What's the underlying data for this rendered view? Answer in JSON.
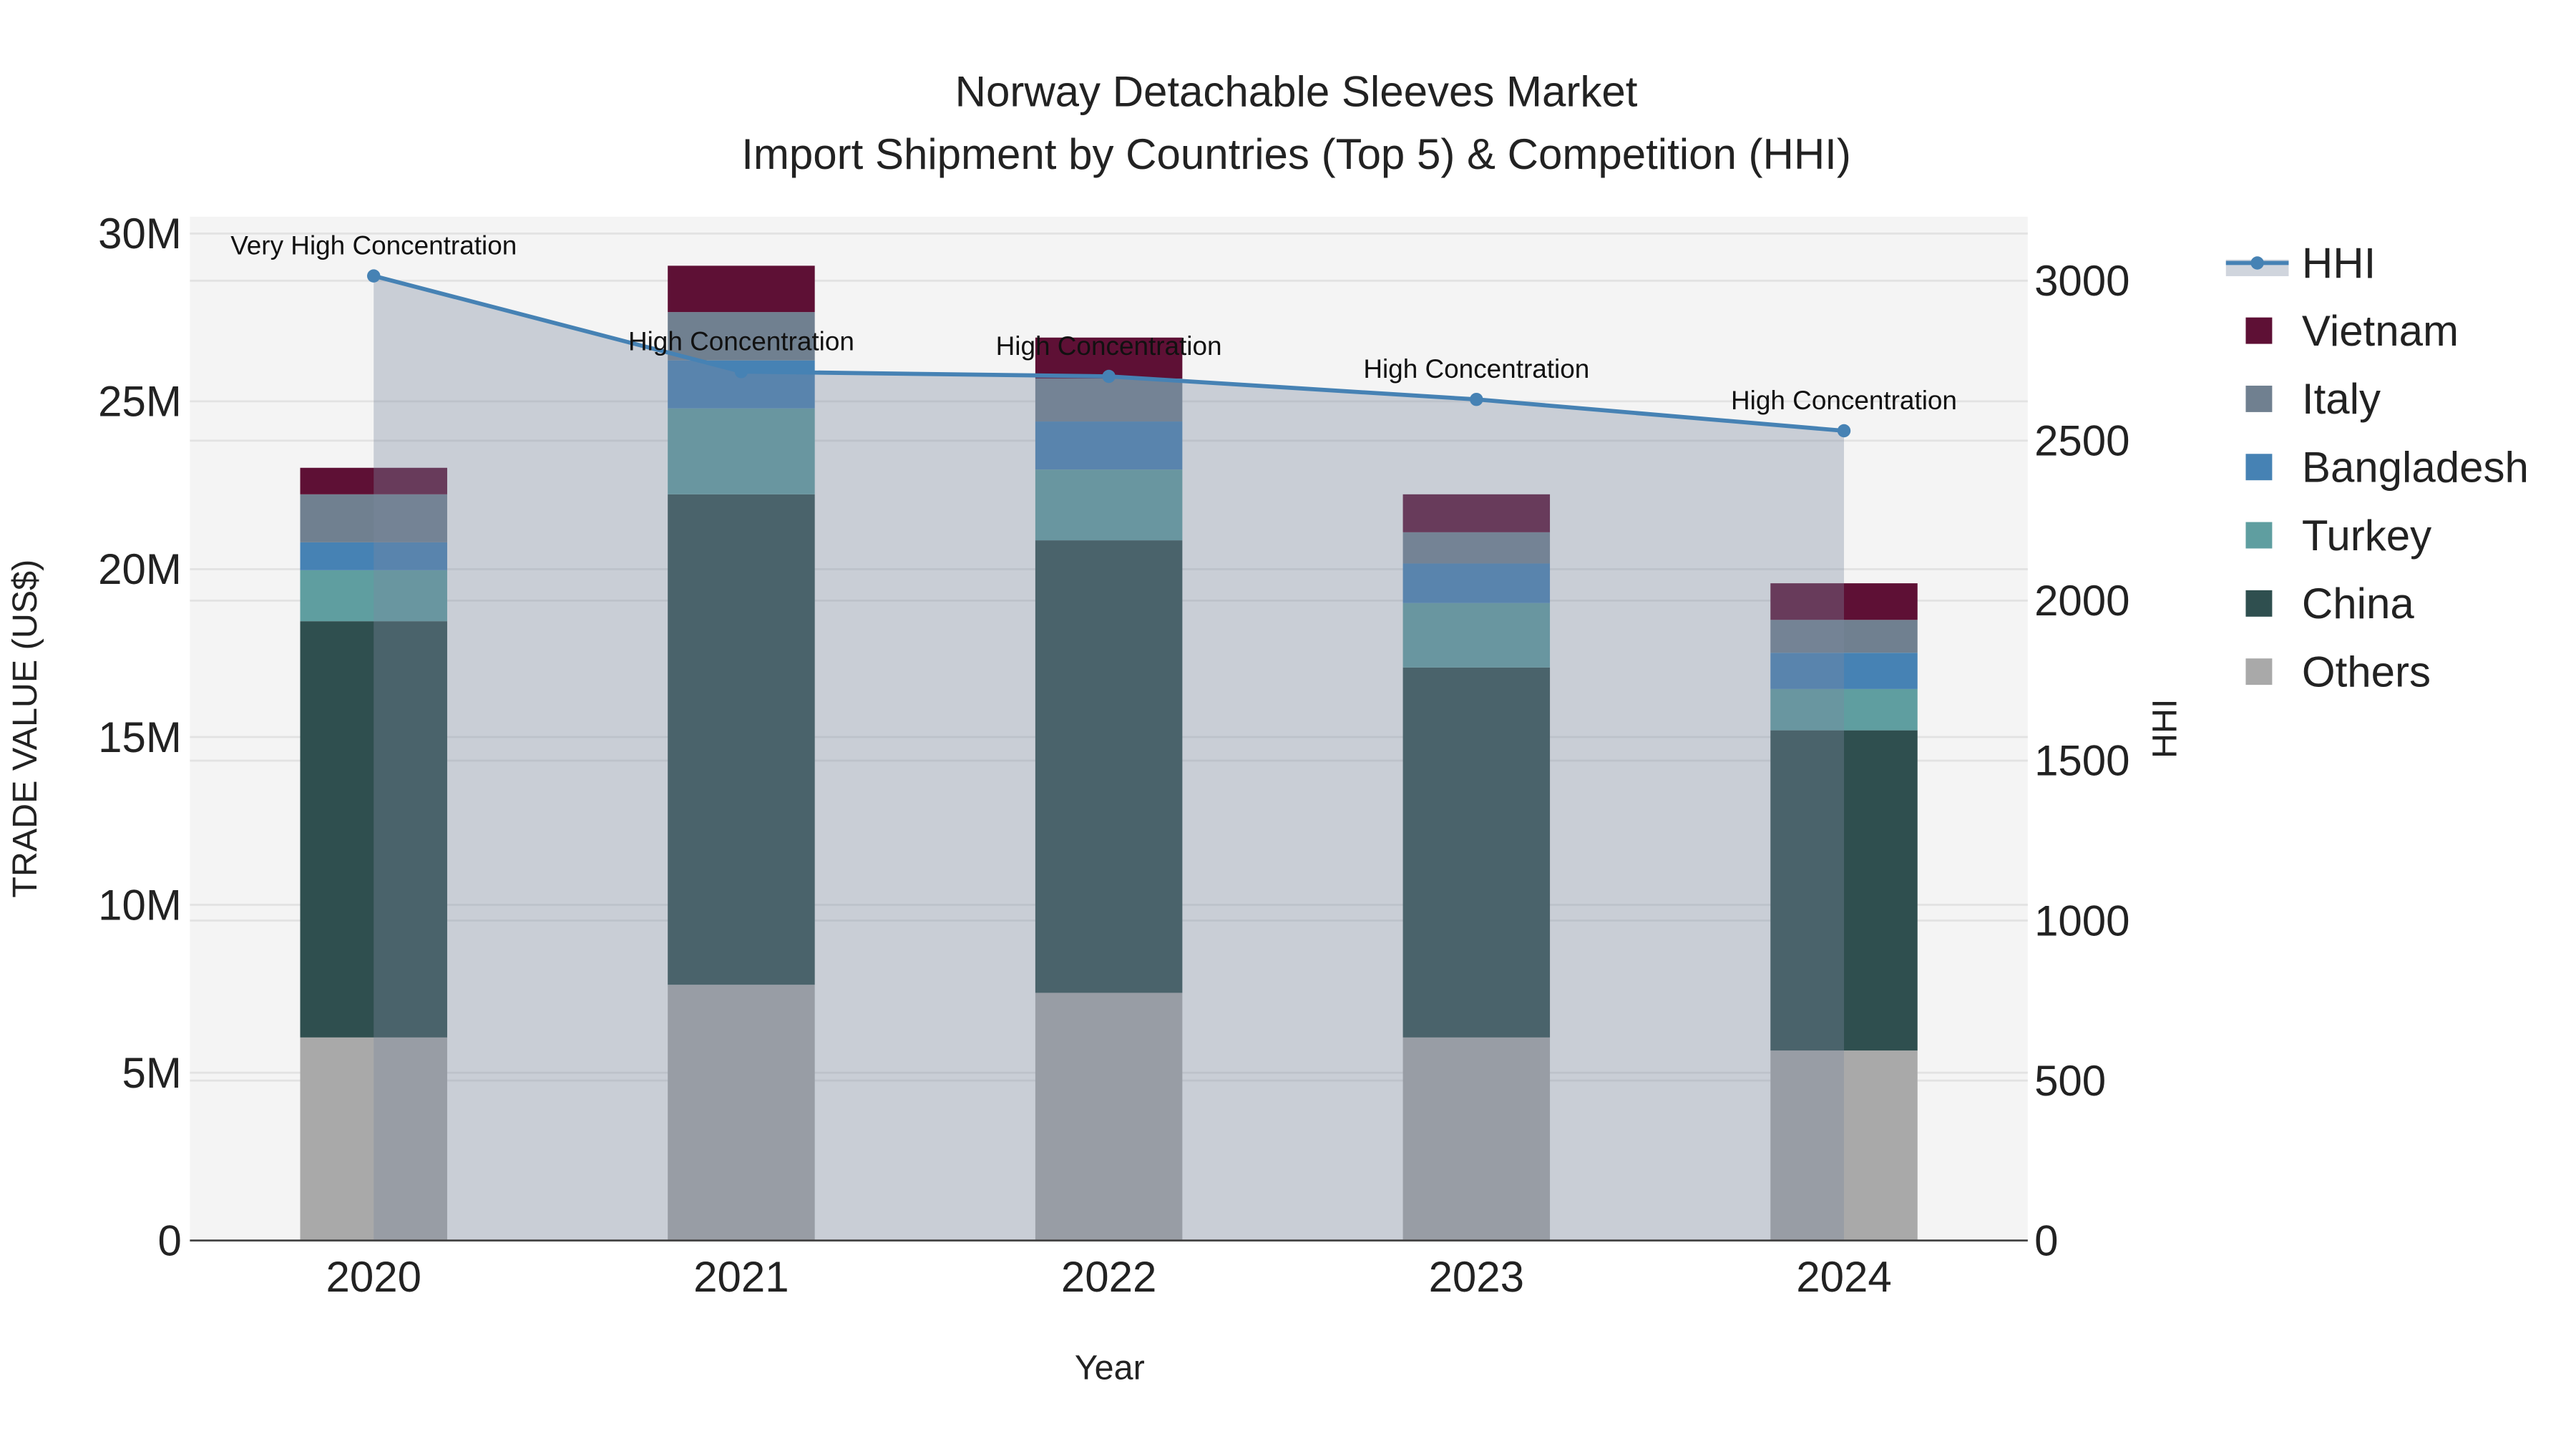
{
  "chart_data": {
    "type": "bar",
    "stacked": true,
    "title": "Norway Detachable Sleeves Market",
    "subtitle": "Import Shipment by Countries (Top 5) & Competition (HHI)",
    "xlabel": "Year",
    "ylabel": "TRADE VALUE (US$)",
    "y2label": "HHI",
    "categories": [
      "2020",
      "2021",
      "2022",
      "2023",
      "2024"
    ],
    "ylim": [
      0,
      30500000
    ],
    "y2lim": [
      0,
      3200
    ],
    "yticks": [
      {
        "v": 0,
        "label": "0"
      },
      {
        "v": 5000000,
        "label": "5M"
      },
      {
        "v": 10000000,
        "label": "10M"
      },
      {
        "v": 15000000,
        "label": "15M"
      },
      {
        "v": 20000000,
        "label": "20M"
      },
      {
        "v": 25000000,
        "label": "25M"
      },
      {
        "v": 30000000,
        "label": "30M"
      }
    ],
    "y2ticks": [
      {
        "v": 0,
        "label": "0"
      },
      {
        "v": 500,
        "label": "500"
      },
      {
        "v": 1000,
        "label": "1000"
      },
      {
        "v": 1500,
        "label": "1500"
      },
      {
        "v": 2000,
        "label": "2000"
      },
      {
        "v": 2500,
        "label": "2500"
      },
      {
        "v": 3000,
        "label": "3000"
      }
    ],
    "series": [
      {
        "name": "Others",
        "color": "#a9a9a9",
        "values": [
          6050000,
          7620000,
          7380000,
          6050000,
          5660000
        ]
      },
      {
        "name": "China",
        "color": "#2f4f4f",
        "values": [
          12400000,
          14610000,
          13480000,
          11020000,
          9540000
        ]
      },
      {
        "name": "Turkey",
        "color": "#5f9ea0",
        "values": [
          1520000,
          2560000,
          2110000,
          1920000,
          1230000
        ]
      },
      {
        "name": "Bangladesh",
        "color": "#4682b4",
        "values": [
          830000,
          1430000,
          1430000,
          1180000,
          1080000
        ]
      },
      {
        "name": "Italy",
        "color": "#708090",
        "values": [
          1430000,
          1440000,
          1280000,
          930000,
          980000
        ]
      },
      {
        "name": "Vietnam",
        "color": "#5e1035",
        "values": [
          790000,
          1380000,
          1220000,
          1130000,
          1090000
        ]
      }
    ],
    "hhi": {
      "name": "HHI",
      "color": "#4682b4",
      "values": [
        3015,
        2716,
        2701,
        2629,
        2531
      ],
      "annotations": [
        "Very High Concentration",
        "High Concentration",
        "High Concentration",
        "High Concentration",
        "High Concentration"
      ]
    },
    "legend": {
      "placement": "right",
      "order": [
        "HHI",
        "Vietnam",
        "Italy",
        "Bangladesh",
        "Turkey",
        "China",
        "Others"
      ]
    },
    "grid": true
  }
}
